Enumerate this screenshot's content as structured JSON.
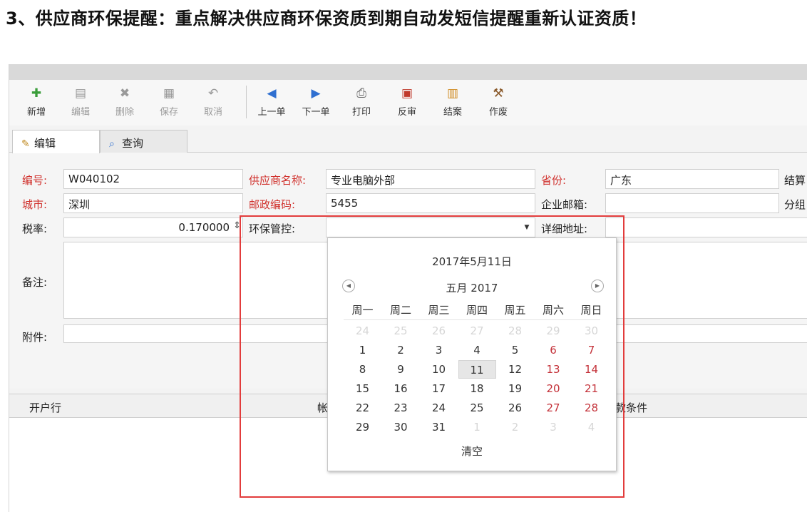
{
  "heading": "3、供应商环保提醒：重点解决供应商环保资质到期自动发短信提醒重新认证资质！",
  "toolbar": [
    {
      "label": "新增",
      "icon": "add-doc-icon",
      "glyph": "✚",
      "color": "#3a9d3a",
      "disabled": false
    },
    {
      "label": "编辑",
      "icon": "edit-doc-icon",
      "glyph": "▤",
      "color": "#999999",
      "disabled": true
    },
    {
      "label": "删除",
      "icon": "delete-icon",
      "glyph": "✖",
      "color": "#999999",
      "disabled": true
    },
    {
      "label": "保存",
      "icon": "save-icon",
      "glyph": "▦",
      "color": "#999999",
      "disabled": true
    },
    {
      "label": "取消",
      "icon": "undo-icon",
      "glyph": "↶",
      "color": "#999999",
      "disabled": true
    },
    {
      "label": "上一单",
      "icon": "prev-record-icon",
      "glyph": "◀",
      "color": "#2f6fd0",
      "disabled": false
    },
    {
      "label": "下一单",
      "icon": "next-record-icon",
      "glyph": "▶",
      "color": "#2f6fd0",
      "disabled": false
    },
    {
      "label": "打印",
      "icon": "printer-icon",
      "glyph": "⎙",
      "color": "#666666",
      "disabled": false
    },
    {
      "label": "反审",
      "icon": "unaudit-icon",
      "glyph": "▣",
      "color": "#c0392b",
      "disabled": false
    },
    {
      "label": "结案",
      "icon": "close-case-icon",
      "glyph": "▥",
      "color": "#d08a1f",
      "disabled": false
    },
    {
      "label": "作废",
      "icon": "void-hammer-icon",
      "glyph": "⚒",
      "color": "#8a5a2b",
      "disabled": false
    }
  ],
  "tabs": [
    {
      "label": "编辑",
      "icon": "edit-pencil-icon",
      "glyph": "✎"
    },
    {
      "label": "查询",
      "icon": "magnifier-icon",
      "glyph": "⌕"
    }
  ],
  "form": {
    "code_label": "编号:",
    "code_value": "W040102",
    "supplier_label": "供应商名称:",
    "supplier_value": "专业电脑外部",
    "province_label": "省份:",
    "province_value": "广东",
    "settle_label": "结算",
    "city_label": "城市:",
    "city_value": "深圳",
    "postcode_label": "邮政编码:",
    "postcode_value": "5455",
    "email_label": "企业邮箱:",
    "email_value": "",
    "group_label": "分组",
    "tax_label": "税率:",
    "tax_value": "0.170000",
    "eco_label": "环保管控:",
    "eco_value": "",
    "address_label": "详细地址:",
    "address_value": "",
    "remark_label": "备注:",
    "attach_label": "附件:"
  },
  "grid": {
    "col_bank": "开户行",
    "col_account_partial": "帐",
    "col_terms_partial": "款条件"
  },
  "calendar": {
    "today_text": "2017年5月11日",
    "month_title": "五月 2017",
    "weekdays": [
      "周一",
      "周二",
      "周三",
      "周四",
      "周五",
      "周六",
      "周日"
    ],
    "weeks": [
      [
        {
          "d": "24",
          "o": true
        },
        {
          "d": "25",
          "o": true
        },
        {
          "d": "26",
          "o": true
        },
        {
          "d": "27",
          "o": true
        },
        {
          "d": "28",
          "o": true
        },
        {
          "d": "29",
          "o": true
        },
        {
          "d": "30",
          "o": true
        }
      ],
      [
        {
          "d": "1"
        },
        {
          "d": "2"
        },
        {
          "d": "3"
        },
        {
          "d": "4"
        },
        {
          "d": "5"
        },
        {
          "d": "6"
        },
        {
          "d": "7"
        }
      ],
      [
        {
          "d": "8"
        },
        {
          "d": "9"
        },
        {
          "d": "10"
        },
        {
          "d": "11",
          "s": true
        },
        {
          "d": "12"
        },
        {
          "d": "13"
        },
        {
          "d": "14"
        }
      ],
      [
        {
          "d": "15"
        },
        {
          "d": "16"
        },
        {
          "d": "17"
        },
        {
          "d": "18"
        },
        {
          "d": "19"
        },
        {
          "d": "20"
        },
        {
          "d": "21"
        }
      ],
      [
        {
          "d": "22"
        },
        {
          "d": "23"
        },
        {
          "d": "24"
        },
        {
          "d": "25"
        },
        {
          "d": "26"
        },
        {
          "d": "27"
        },
        {
          "d": "28"
        }
      ],
      [
        {
          "d": "29"
        },
        {
          "d": "30"
        },
        {
          "d": "31"
        },
        {
          "d": "1",
          "o": true
        },
        {
          "d": "2",
          "o": true
        },
        {
          "d": "3",
          "o": true
        },
        {
          "d": "4",
          "o": true
        }
      ]
    ],
    "clear_label": "清空",
    "weekend_color": "#c4323a",
    "selected_bg": "#e6e6e6"
  },
  "highlight_color": "#e23c3c"
}
